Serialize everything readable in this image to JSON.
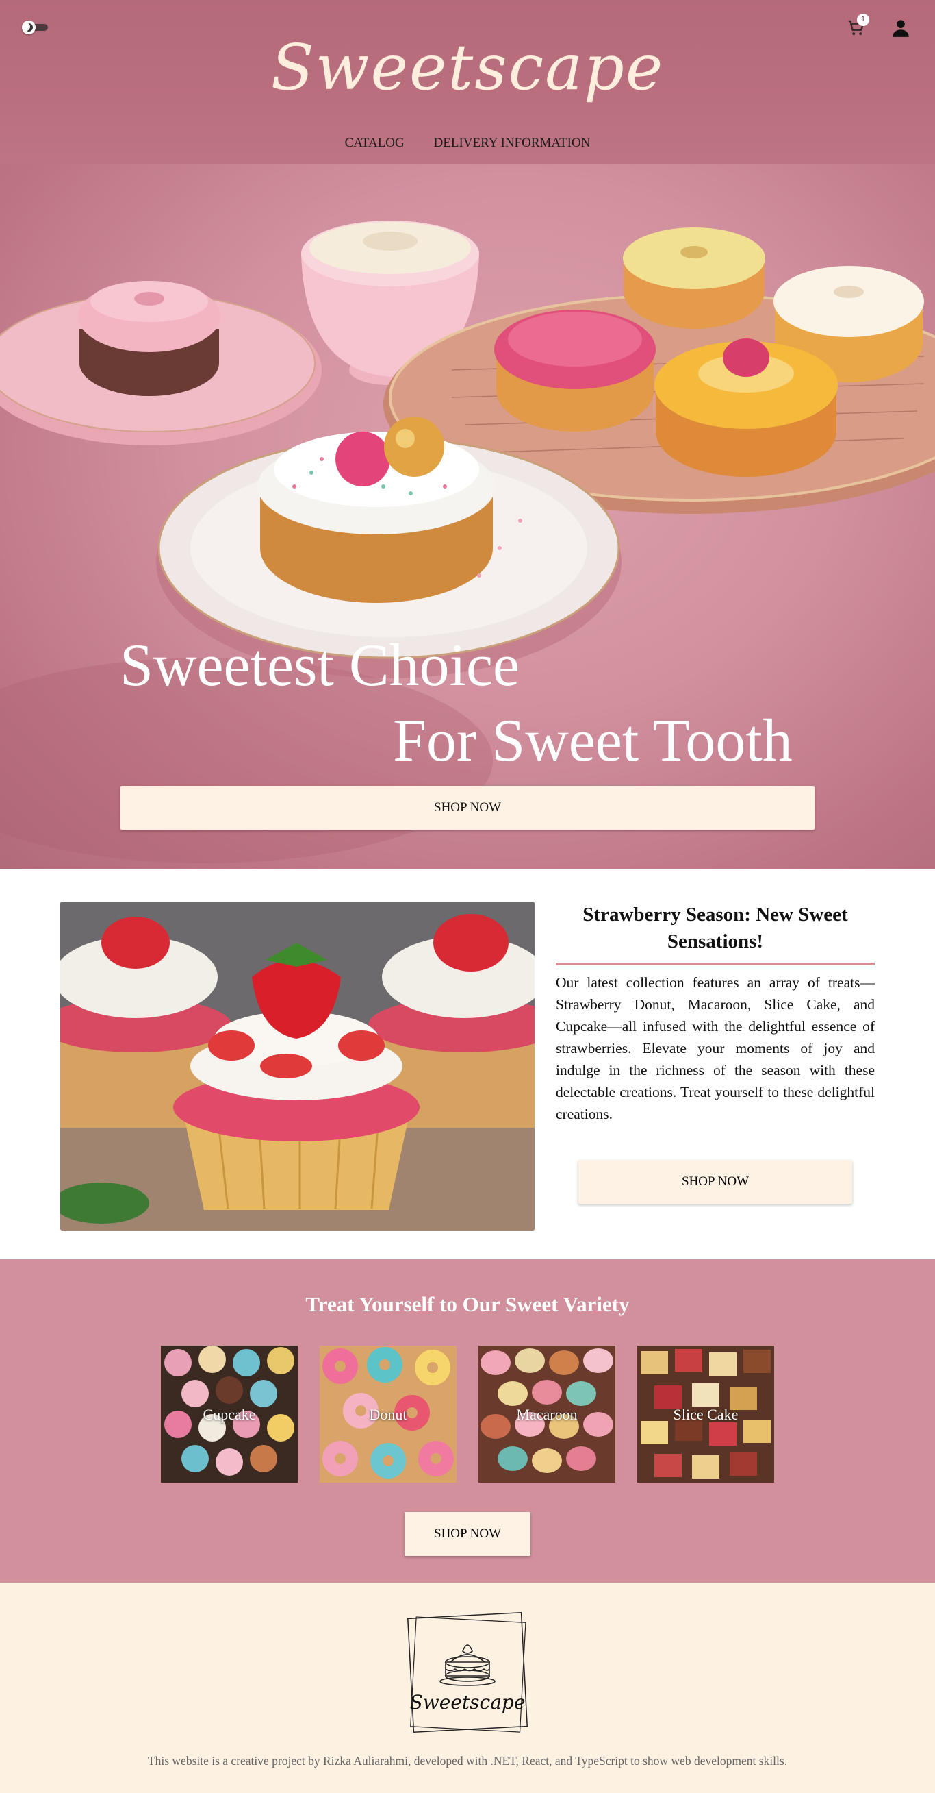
{
  "header": {
    "brand": "Sweetscape",
    "cart_count": "1",
    "nav": [
      {
        "label": "CATALOG"
      },
      {
        "label": "DELIVERY INFORMATION"
      }
    ],
    "icons": {
      "theme": "moon-toggle-icon",
      "cart": "cart-icon",
      "user": "user-icon"
    }
  },
  "hero": {
    "title_line1": "Sweetest Choice",
    "title_line2": "For Sweet Tooth",
    "cta": "SHOP NOW"
  },
  "promo": {
    "title": "Strawberry Season: New Sweet Sensations!",
    "body": "Our latest collection features an array of treats—Strawberry Donut, Macaroon, Slice Cake, and Cupcake—all infused with the delightful essence of strawberries. Elevate your moments of joy and indulge in the richness of the season with these delectable creations. Treat yourself to these delightful creations.",
    "cta": "SHOP NOW"
  },
  "variety": {
    "title": "Treat Yourself to Our Sweet Variety",
    "items": [
      {
        "label": "Cupcake"
      },
      {
        "label": "Donut"
      },
      {
        "label": "Macaroon"
      },
      {
        "label": "Slice Cake"
      }
    ],
    "cta": "SHOP NOW"
  },
  "footer": {
    "logo_text": "Sweetscape",
    "credit": "This website is a creative project by Rizka Auliarahmi, developed with .NET, React, and TypeScript to show web development skills."
  },
  "colors": {
    "header_bg": "#b96e7d",
    "hero_bg": "#d1909e",
    "cream": "#fdf2e4",
    "variety_bg": "#d2909d",
    "accent_rule": "#d98d98"
  }
}
